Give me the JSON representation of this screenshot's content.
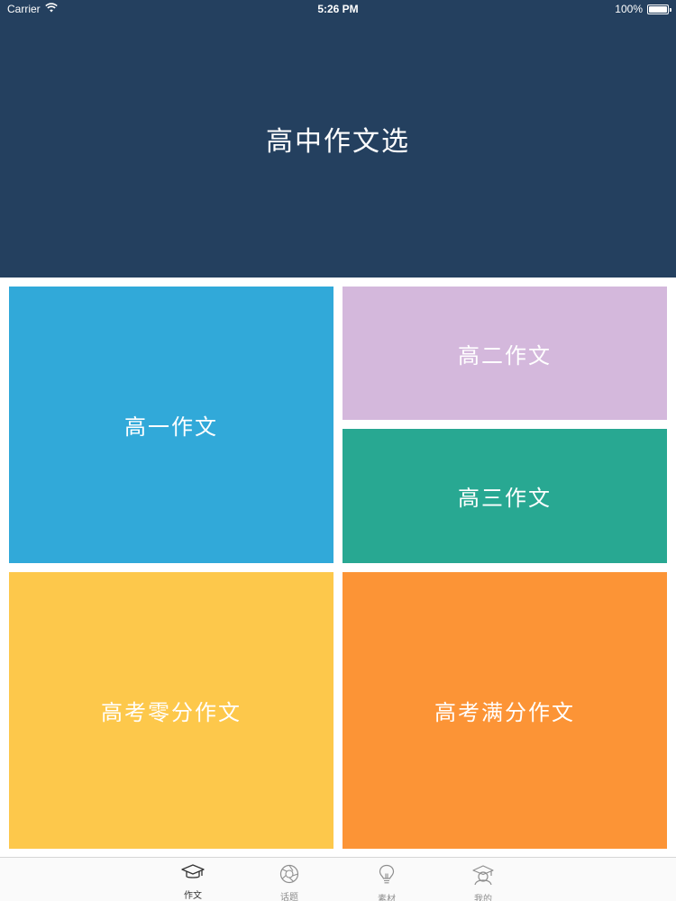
{
  "status_bar": {
    "carrier": "Carrier",
    "time": "5:26 PM",
    "battery": "100%",
    "battery_level": 1.0
  },
  "header": {
    "title": "高中作文选",
    "background": "#24405f"
  },
  "tiles": [
    {
      "label": "高一作文",
      "color": "#31a9d9"
    },
    {
      "label": "高二作文",
      "color": "#d4b8dc"
    },
    {
      "label": "高三作文",
      "color": "#28a892"
    },
    {
      "label": "高考零分作文",
      "color": "#fdc84b"
    },
    {
      "label": "高考满分作文",
      "color": "#fc9436"
    }
  ],
  "tab_bar": {
    "tabs": [
      {
        "label": "作文",
        "icon": "graduation-cap-icon",
        "active": true
      },
      {
        "label": "话题",
        "icon": "aperture-icon",
        "active": false
      },
      {
        "label": "素材",
        "icon": "lightbulb-icon",
        "active": false
      },
      {
        "label": "我的",
        "icon": "profile-icon",
        "active": false
      }
    ]
  }
}
